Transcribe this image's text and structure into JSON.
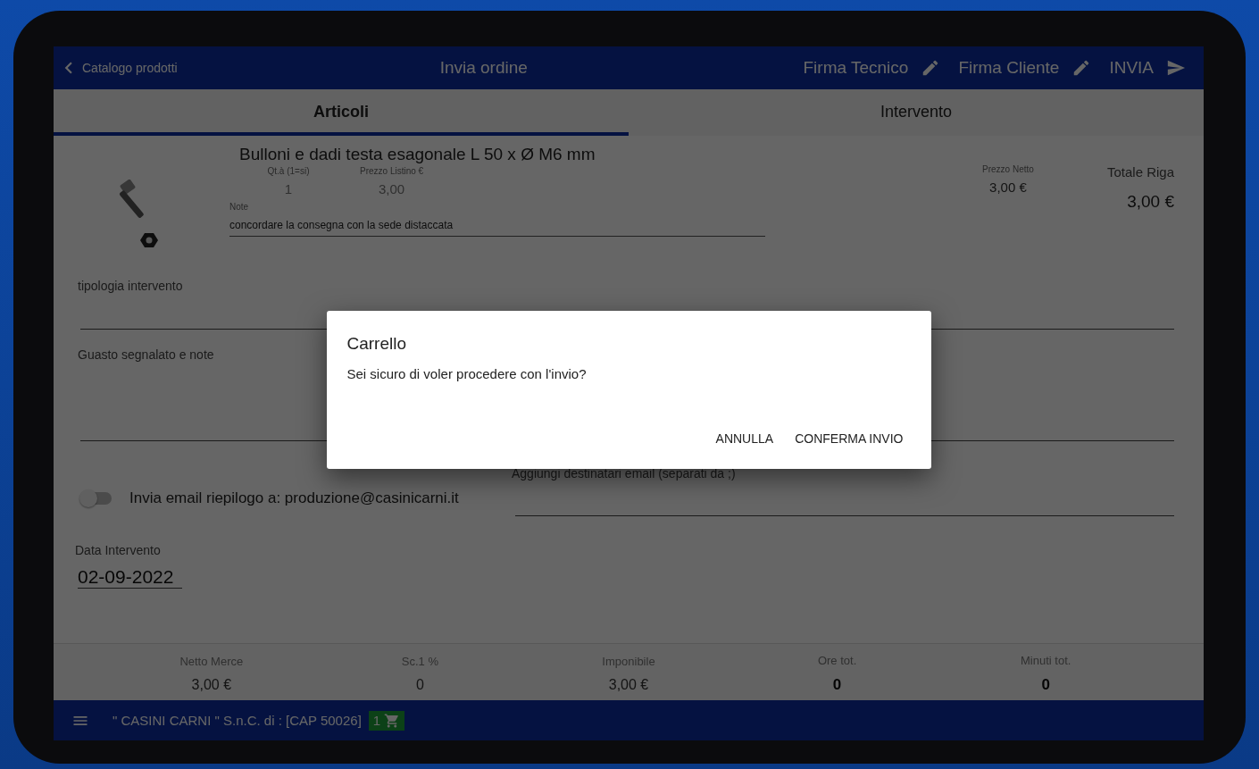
{
  "header": {
    "back": "Catalogo prodotti",
    "title": "Invia ordine",
    "actions": [
      {
        "label": "Firma Tecnico",
        "kind": "pencil"
      },
      {
        "label": "Firma Cliente",
        "kind": "pencil"
      },
      {
        "label": "INVIA",
        "kind": "send"
      }
    ]
  },
  "tabs": [
    {
      "label": "Articoli",
      "selected": true
    },
    {
      "label": "Intervento",
      "selected": false
    }
  ],
  "item": {
    "name": "Bulloni e dadi testa esagonale L 50 x Ø M6 mm",
    "fields": [
      {
        "label": "Qt.à (1=si)",
        "value": "1"
      },
      {
        "label": "Prezzo Listino €",
        "value": "3,00"
      }
    ],
    "note": {
      "label": "Note",
      "value": "concordare la consegna con la sede distaccata"
    },
    "net": {
      "label": "Prezzo Netto",
      "value": "3,00 €"
    },
    "total": {
      "label": "Totale Riga",
      "value": "3,00 €"
    }
  },
  "form": {
    "type_field": {
      "label": "tipologia intervento"
    },
    "fault_field": {
      "label": "Guasto segnalato e note"
    },
    "email_toggle": {
      "label": "Invia email riepilogo a: produzione@casinicarni.it",
      "on": false
    },
    "extra_recipients": {
      "label": "Aggiungi destinatari email (separati da ;)"
    },
    "date": {
      "label": "Data Intervento",
      "value": "02-09-2022"
    }
  },
  "totals": [
    {
      "label": "Netto Merce",
      "value": "3,00 €",
      "bold": false
    },
    {
      "label": "Sc.1 %",
      "value": "0",
      "bold": false
    },
    {
      "label": "Imponibile",
      "value": "3,00 €",
      "bold": false
    },
    {
      "label": "Ore tot.",
      "value": "0",
      "bold": true
    },
    {
      "label": "Minuti tot.",
      "value": "0",
      "bold": true
    }
  ],
  "bottom_bar": {
    "company": "\" CASINI CARNI \" S.n.C. di : [CAP 50026]",
    "cart_count": "1"
  },
  "dialog": {
    "title": "Carrello",
    "message": "Sei sicuro di voler procedere con l'invio?",
    "buttons": [
      "ANNULLA",
      "CONFERMA INVIO"
    ]
  }
}
